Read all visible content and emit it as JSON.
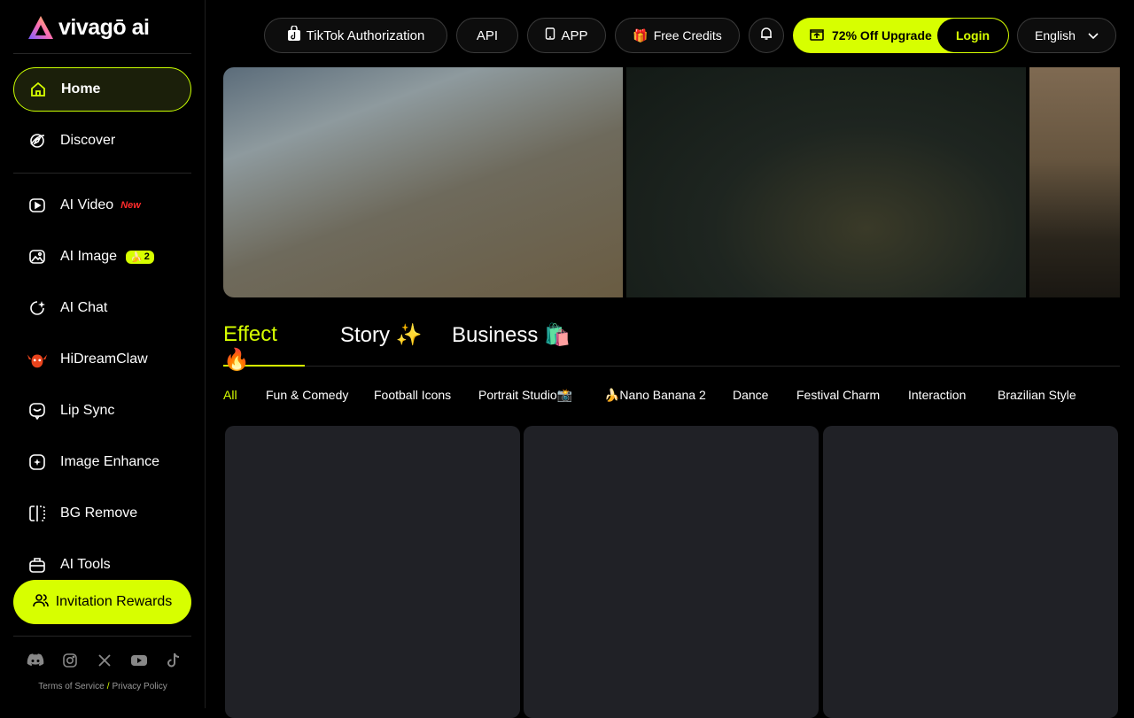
{
  "brand": {
    "name": "vivagō ai"
  },
  "sidebar": {
    "home": "Home",
    "discover": "Discover",
    "items": [
      {
        "label": "AI Video",
        "badge": "New",
        "icon": "video-icon"
      },
      {
        "label": "AI Image",
        "badge": "2",
        "icon": "image-icon"
      },
      {
        "label": "AI Chat",
        "icon": "chat-icon"
      },
      {
        "label": "HiDreamClaw",
        "icon": "claw-icon"
      },
      {
        "label": "Lip Sync",
        "icon": "lip-sync-icon"
      },
      {
        "label": "Image Enhance",
        "icon": "enhance-icon"
      },
      {
        "label": "BG Remove",
        "icon": "bg-remove-icon"
      },
      {
        "label": "AI Tools",
        "icon": "tools-icon"
      }
    ],
    "invite": "Invitation Rewards",
    "socials": [
      "discord-icon",
      "instagram-icon",
      "x-icon",
      "youtube-icon",
      "tiktok-icon"
    ],
    "terms": "Terms of Service",
    "separator": "/",
    "privacy": "Privacy Policy"
  },
  "topbar": {
    "tiktok": "TikTok Authorization",
    "api": "API",
    "app": "APP",
    "free_credits": "Free Credits",
    "upgrade": "72% Off Upgrade",
    "login": "Login",
    "language": "English"
  },
  "tabs": [
    "Effect 🔥",
    "Story ✨",
    "Business 🛍️"
  ],
  "chips": [
    "All",
    "Fun & Comedy",
    "Football Icons",
    "Portrait Studio📸",
    "🍌Nano Banana 2",
    "Dance",
    "Festival Charm",
    "Interaction",
    "Brazilian Style"
  ],
  "colors": {
    "accent": "#d7ff00",
    "card": "#202126",
    "new_badge": "#ff2b2b"
  }
}
